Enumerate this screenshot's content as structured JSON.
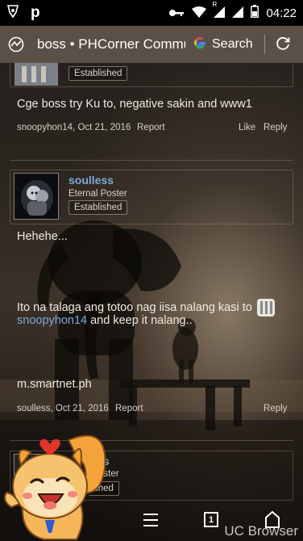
{
  "status_bar": {
    "time": "04:22",
    "icons": [
      "pokemon-go-icon",
      "p-app-icon",
      "key-icon",
      "wifi-icon",
      "roaming-signal-icon",
      "signal-icon",
      "battery-icon"
    ],
    "p_label": "p",
    "roaming_label": "R"
  },
  "browser": {
    "page_title": "boss • PHCorner Commu",
    "search_label": "Search"
  },
  "posts": [
    {
      "badge": "Established",
      "body": "Cge boss try Ku to, negative sakin and www1",
      "meta": "snoopyhon14, Oct 21, 2016",
      "report": "Report",
      "like": "Like",
      "reply": "Reply"
    },
    {
      "username": "soulless",
      "user_title": "Eternal Poster",
      "badge": "Established",
      "body_line1": "Hehehe...",
      "body_line2_prefix": "Ito na talaga ang totoo nag iisa nalang kasi to",
      "body_line3_mention": "snoopyhon14",
      "body_line3_suffix": " and keep it nalang..",
      "body_line4": "m.smartnet.ph",
      "meta": "soulless, Oct 21, 2016",
      "report": "Report",
      "reply": "Reply"
    },
    {
      "username_partial": "s",
      "user_title_partial": "oster",
      "badge_partial": "shed"
    }
  ],
  "bottom_nav": {
    "tab_count": "1"
  },
  "watermark": "UC Browser",
  "colors": {
    "link": "#7fa9d6",
    "url_bar": "#5f554c",
    "status_bar": "#000000"
  }
}
